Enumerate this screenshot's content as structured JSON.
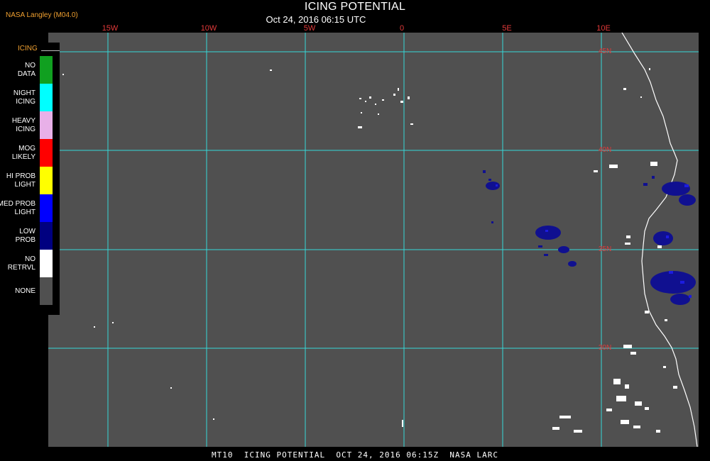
{
  "header": {
    "source_label": "NASA Langley (M04.0)",
    "title": "ICING POTENTIAL",
    "subtitle": "Oct 24, 2016 06:15 UTC"
  },
  "map": {
    "longitude_labels": [
      "15W",
      "10W",
      "5W",
      "0",
      "5E",
      "10E"
    ],
    "latitude_labels": [
      "45N",
      "40N",
      "35N",
      "30N"
    ],
    "grid_color": "#36d8d8",
    "background_color": "#505050",
    "coastline_color": "#ffffff"
  },
  "legend": {
    "title": "ICING",
    "items": [
      {
        "label": "NO DATA",
        "color": "#10a020"
      },
      {
        "label": "NIGHT ICING",
        "color": "#00ffff"
      },
      {
        "label": "HEAVY ICING",
        "color": "#e8b0e8"
      },
      {
        "label": "MOG LIKELY",
        "color": "#ff0000"
      },
      {
        "label": "HI PROB LIGHT",
        "color": "#ffff00"
      },
      {
        "label": "MED PROB LIGHT",
        "color": "#0000ff"
      },
      {
        "label": "LOW PROB",
        "color": "#000080"
      },
      {
        "label": "NO RETRVL",
        "color": "#ffffff"
      },
      {
        "label": "NONE",
        "color": "#505050"
      }
    ]
  },
  "footer": {
    "caption": "MT10  ICING POTENTIAL  OCT 24, 2016 06:15Z  NASA LARC"
  }
}
